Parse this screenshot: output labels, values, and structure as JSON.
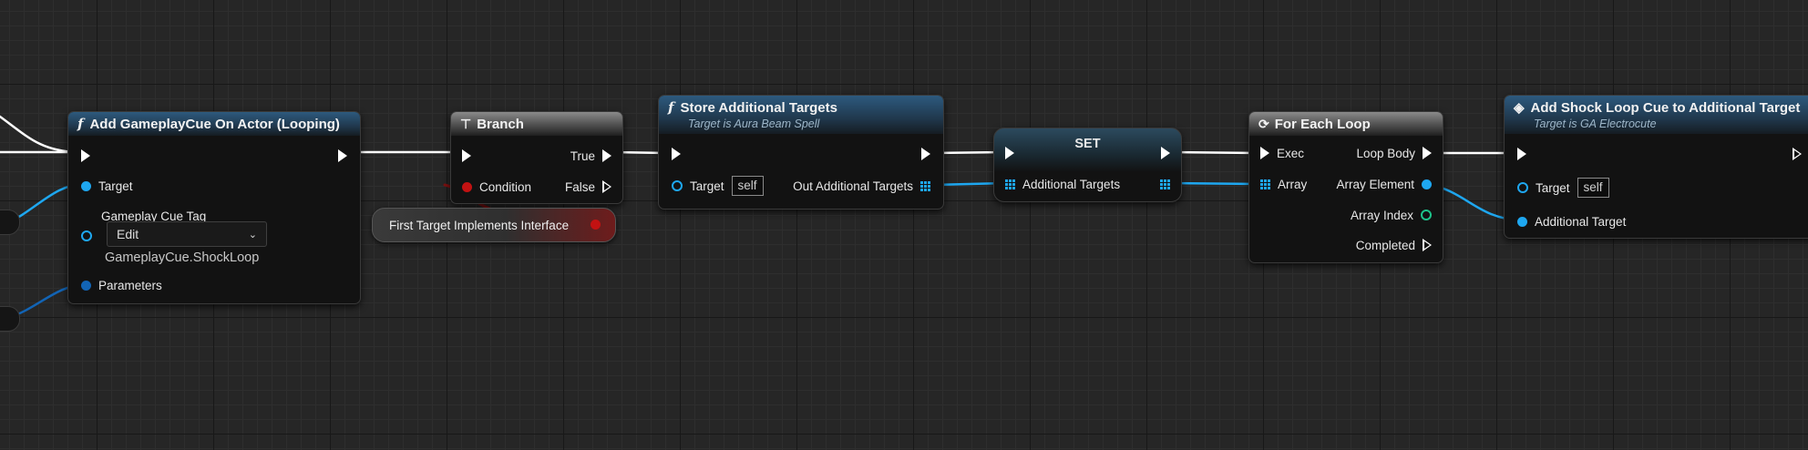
{
  "nodes": {
    "add_cue": {
      "title": "Add GameplayCue On Actor (Looping)",
      "target_label": "Target",
      "cue_tag_label": "Gameplay Cue Tag",
      "edit_label": "Edit",
      "cue_tag_value": "GameplayCue.ShockLoop",
      "parameters_label": "Parameters"
    },
    "branch": {
      "title": "Branch",
      "true_label": "True",
      "condition_label": "Condition",
      "false_label": "False"
    },
    "interface_check": {
      "label": "First Target Implements Interface"
    },
    "store_targets": {
      "title": "Store Additional Targets",
      "subtitle": "Target is Aura Beam Spell",
      "target_label": "Target",
      "target_value": "self",
      "out_label": "Out Additional Targets"
    },
    "set_node": {
      "title": "SET",
      "additional_targets_label": "Additional Targets"
    },
    "for_each": {
      "title": "For Each Loop",
      "exec_label": "Exec",
      "loop_body_label": "Loop Body",
      "array_label": "Array",
      "array_element_label": "Array Element",
      "array_index_label": "Array Index",
      "completed_label": "Completed"
    },
    "add_shock": {
      "title": "Add Shock Loop Cue to Additional Target",
      "subtitle": "Target is GA Electrocute",
      "target_label": "Target",
      "target_value": "self",
      "additional_target_label": "Additional Target"
    }
  },
  "colors": {
    "exec_wire": "#ffffff",
    "object_wire": "#1ea7f0",
    "bool_pin": "#c21212",
    "int_pin": "#1dc38a",
    "function_header": "#2d5a7e",
    "macro_header": "#8a8a8a"
  }
}
